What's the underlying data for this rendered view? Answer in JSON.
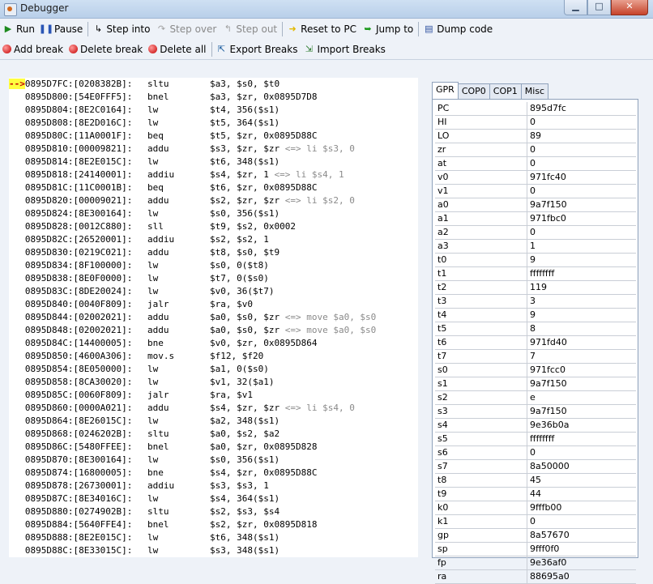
{
  "window": {
    "title": "Debugger"
  },
  "toolbar": {
    "run": "Run",
    "pause": "Pause",
    "step_into": "Step into",
    "step_over": "Step over",
    "step_out": "Step out",
    "reset_pc": "Reset to PC",
    "jump_to": "Jump to",
    "dump_code": "Dump code",
    "add_break": "Add break",
    "delete_break": "Delete break",
    "delete_all": "Delete all",
    "export_breaks": "Export Breaks",
    "import_breaks": "Import Breaks"
  },
  "disasm": {
    "pc_marker": "-->",
    "lines": [
      {
        "addr": "0895D7FC:[0208382B]:",
        "mnem": "sltu",
        "ops": "$a3, $s0, $t0",
        "hint": ""
      },
      {
        "addr": "0895D800:[54E0FFF5]:",
        "mnem": "bnel",
        "ops": "$a3, $zr, 0x0895D7D8",
        "hint": ""
      },
      {
        "addr": "0895D804:[8E2C0164]:",
        "mnem": "lw",
        "ops": "$t4, 356($s1)",
        "hint": ""
      },
      {
        "addr": "0895D808:[8E2D016C]:",
        "mnem": "lw",
        "ops": "$t5, 364($s1)",
        "hint": ""
      },
      {
        "addr": "0895D80C:[11A0001F]:",
        "mnem": "beq",
        "ops": "$t5, $zr, 0x0895D88C",
        "hint": ""
      },
      {
        "addr": "0895D810:[00009821]:",
        "mnem": "addu",
        "ops": "$s3, $zr, $zr ",
        "hint": "<=> li $s3, 0"
      },
      {
        "addr": "0895D814:[8E2E015C]:",
        "mnem": "lw",
        "ops": "$t6, 348($s1)",
        "hint": ""
      },
      {
        "addr": "0895D818:[24140001]:",
        "mnem": "addiu",
        "ops": "$s4, $zr, 1 ",
        "hint": "<=> li $s4, 1"
      },
      {
        "addr": "0895D81C:[11C0001B]:",
        "mnem": "beq",
        "ops": "$t6, $zr, 0x0895D88C",
        "hint": ""
      },
      {
        "addr": "0895D820:[00009021]:",
        "mnem": "addu",
        "ops": "$s2, $zr, $zr ",
        "hint": "<=> li $s2, 0"
      },
      {
        "addr": "0895D824:[8E300164]:",
        "mnem": "lw",
        "ops": "$s0, 356($s1)",
        "hint": ""
      },
      {
        "addr": "0895D828:[0012C880]:",
        "mnem": "sll",
        "ops": "$t9, $s2, 0x0002",
        "hint": ""
      },
      {
        "addr": "0895D82C:[26520001]:",
        "mnem": "addiu",
        "ops": "$s2, $s2, 1",
        "hint": ""
      },
      {
        "addr": "0895D830:[0219C021]:",
        "mnem": "addu",
        "ops": "$t8, $s0, $t9",
        "hint": ""
      },
      {
        "addr": "0895D834:[8F100000]:",
        "mnem": "lw",
        "ops": "$s0, 0($t8)",
        "hint": ""
      },
      {
        "addr": "0895D838:[8E0F0000]:",
        "mnem": "lw",
        "ops": "$t7, 0($s0)",
        "hint": ""
      },
      {
        "addr": "0895D83C:[8DE20024]:",
        "mnem": "lw",
        "ops": "$v0, 36($t7)",
        "hint": ""
      },
      {
        "addr": "0895D840:[0040F809]:",
        "mnem": "jalr",
        "ops": "$ra, $v0",
        "hint": ""
      },
      {
        "addr": "0895D844:[02002021]:",
        "mnem": "addu",
        "ops": "$a0, $s0, $zr ",
        "hint": "<=> move $a0, $s0"
      },
      {
        "addr": "0895D848:[02002021]:",
        "mnem": "addu",
        "ops": "$a0, $s0, $zr ",
        "hint": "<=> move $a0, $s0"
      },
      {
        "addr": "0895D84C:[14400005]:",
        "mnem": "bne",
        "ops": "$v0, $zr, 0x0895D864",
        "hint": ""
      },
      {
        "addr": "0895D850:[4600A306]:",
        "mnem": "mov.s",
        "ops": "$f12, $f20",
        "hint": ""
      },
      {
        "addr": "0895D854:[8E050000]:",
        "mnem": "lw",
        "ops": "$a1, 0($s0)",
        "hint": ""
      },
      {
        "addr": "0895D858:[8CA30020]:",
        "mnem": "lw",
        "ops": "$v1, 32($a1)",
        "hint": ""
      },
      {
        "addr": "0895D85C:[0060F809]:",
        "mnem": "jalr",
        "ops": "$ra, $v1",
        "hint": ""
      },
      {
        "addr": "0895D860:[0000A021]:",
        "mnem": "addu",
        "ops": "$s4, $zr, $zr ",
        "hint": "<=> li $s4, 0"
      },
      {
        "addr": "0895D864:[8E26015C]:",
        "mnem": "lw",
        "ops": "$a2, 348($s1)",
        "hint": ""
      },
      {
        "addr": "0895D868:[0246202B]:",
        "mnem": "sltu",
        "ops": "$a0, $s2, $a2",
        "hint": ""
      },
      {
        "addr": "0895D86C:[5480FFEE]:",
        "mnem": "bnel",
        "ops": "$a0, $zr, 0x0895D828",
        "hint": ""
      },
      {
        "addr": "0895D870:[8E300164]:",
        "mnem": "lw",
        "ops": "$s0, 356($s1)",
        "hint": ""
      },
      {
        "addr": "0895D874:[16800005]:",
        "mnem": "bne",
        "ops": "$s4, $zr, 0x0895D88C",
        "hint": ""
      },
      {
        "addr": "0895D878:[26730001]:",
        "mnem": "addiu",
        "ops": "$s3, $s3, 1",
        "hint": ""
      },
      {
        "addr": "0895D87C:[8E34016C]:",
        "mnem": "lw",
        "ops": "$s4, 364($s1)",
        "hint": ""
      },
      {
        "addr": "0895D880:[0274902B]:",
        "mnem": "sltu",
        "ops": "$s2, $s3, $s4",
        "hint": ""
      },
      {
        "addr": "0895D884:[5640FFE4]:",
        "mnem": "bnel",
        "ops": "$s2, $zr, 0x0895D818",
        "hint": ""
      },
      {
        "addr": "0895D888:[8E2E015C]:",
        "mnem": "lw",
        "ops": "$t6, 348($s1)",
        "hint": ""
      },
      {
        "addr": "0895D88C:[8E33015C]:",
        "mnem": "lw",
        "ops": "$s3, 348($s1)",
        "hint": ""
      }
    ]
  },
  "regpanel": {
    "tabs": [
      "GPR",
      "COP0",
      "COP1",
      "Misc"
    ],
    "active_tab": "GPR",
    "registers": [
      [
        "PC",
        "895d7fc"
      ],
      [
        "HI",
        "0"
      ],
      [
        "LO",
        "89"
      ],
      [
        "zr",
        "0"
      ],
      [
        "at",
        "0"
      ],
      [
        "v0",
        "971fc40"
      ],
      [
        "v1",
        "0"
      ],
      [
        "a0",
        "9a7f150"
      ],
      [
        "a1",
        "971fbc0"
      ],
      [
        "a2",
        "0"
      ],
      [
        "a3",
        "1"
      ],
      [
        "t0",
        "9"
      ],
      [
        "t1",
        "ffffffff"
      ],
      [
        "t2",
        "119"
      ],
      [
        "t3",
        "3"
      ],
      [
        "t4",
        "9"
      ],
      [
        "t5",
        "8"
      ],
      [
        "t6",
        "971fd40"
      ],
      [
        "t7",
        "7"
      ],
      [
        "s0",
        "971fcc0"
      ],
      [
        "s1",
        "9a7f150"
      ],
      [
        "s2",
        "e"
      ],
      [
        "s3",
        "9a7f150"
      ],
      [
        "s4",
        "9e36b0a"
      ],
      [
        "s5",
        "ffffffff"
      ],
      [
        "s6",
        "0"
      ],
      [
        "s7",
        "8a50000"
      ],
      [
        "t8",
        "45"
      ],
      [
        "t9",
        "44"
      ],
      [
        "k0",
        "9fffb00"
      ],
      [
        "k1",
        "0"
      ],
      [
        "gp",
        "8a57670"
      ],
      [
        "sp",
        "9fff0f0"
      ],
      [
        "fp",
        "9e36af0"
      ],
      [
        "ra",
        "88695a0"
      ]
    ]
  }
}
